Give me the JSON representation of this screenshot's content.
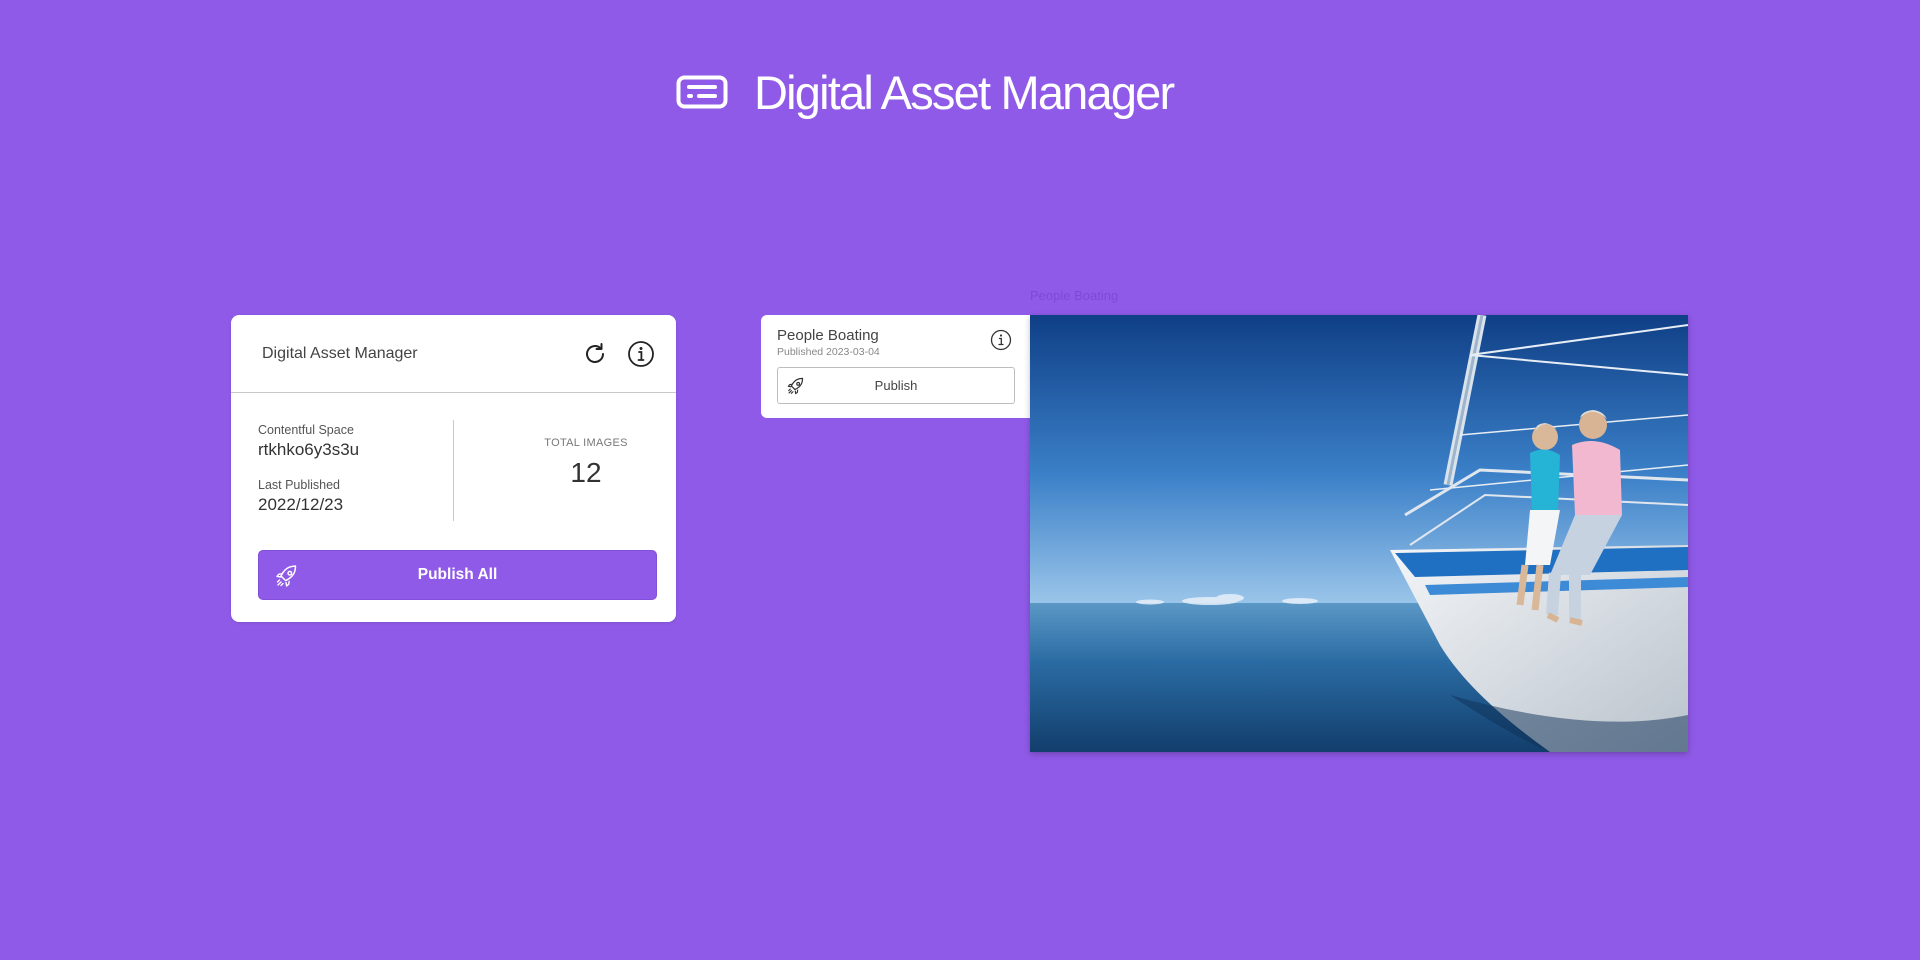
{
  "header": {
    "title": "Digital Asset Manager",
    "logo_icon": "server-card-icon"
  },
  "summary": {
    "title": "Digital Asset Manager",
    "refresh_icon": "refresh-icon",
    "info_icon": "info-icon",
    "space_label": "Contentful Space",
    "space_value": "rtkhko6y3s3u",
    "last_published_label": "Last Published",
    "last_published_value": "2022/12/23",
    "total_images_label": "TOTAL IMAGES",
    "total_images_value": "12",
    "publish_all_label": "Publish All",
    "publish_all_icon": "rocket-icon"
  },
  "asset": {
    "name": "People Boating",
    "published": "Published 2023-03-04",
    "publish_label": "Publish",
    "publish_icon": "rocket-icon",
    "info_icon": "info-icon",
    "image_caption": "People Boating",
    "image_alt": "People Boating"
  },
  "colors": {
    "background": "#905ae8",
    "accent": "#905ae8",
    "card": "#ffffff"
  }
}
